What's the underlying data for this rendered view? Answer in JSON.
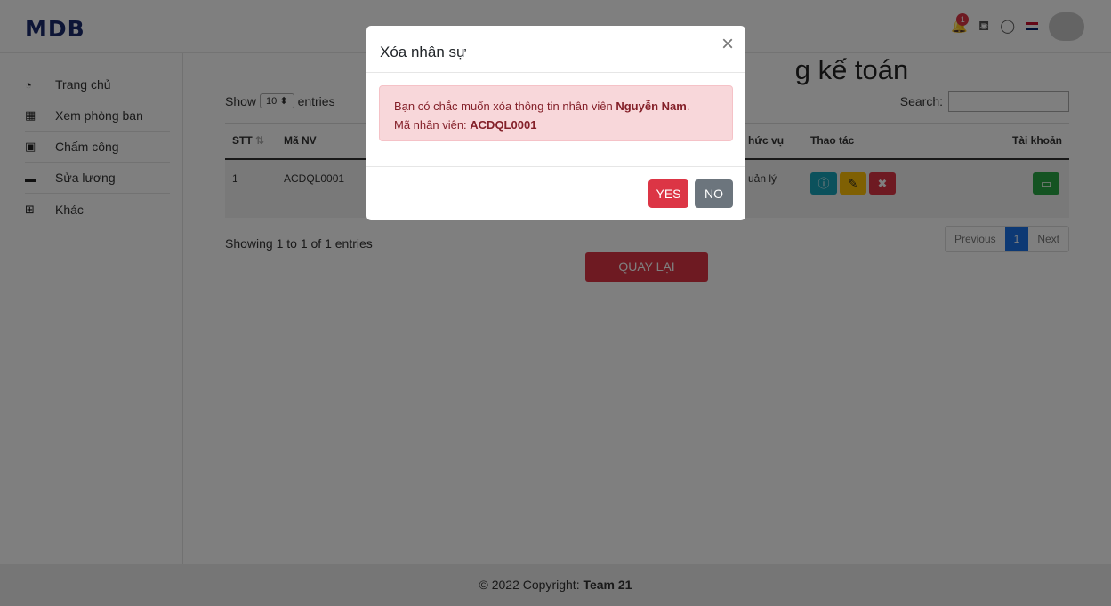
{
  "header": {
    "logo": "MDB",
    "notification_count": "1"
  },
  "sidebar": {
    "items": [
      {
        "label": "Trang chủ",
        "icon": "dashboard-icon"
      },
      {
        "label": "Xem phòng ban",
        "icon": "building-icon"
      },
      {
        "label": "Chấm công",
        "icon": "calendar-icon"
      },
      {
        "label": "Sửa lương",
        "icon": "money-icon"
      },
      {
        "label": "Khác",
        "icon": "grid-icon"
      }
    ]
  },
  "main": {
    "title_fragment": "g kế toán",
    "show_label": "Show",
    "entries_select": "10",
    "entries_label": "entries",
    "search_label": "Search:",
    "table": {
      "headers": [
        "STT",
        "Mã NV",
        "hức vụ",
        "Thao tác",
        "Tài khoản"
      ],
      "rows": [
        {
          "stt": "1",
          "ma_nv": "ACDQL0001",
          "chuc_vu": "uản lý"
        }
      ]
    },
    "showing": "Showing 1 to 1 of 1 entries",
    "pager": {
      "previous": "Previous",
      "current": "1",
      "next": "Next"
    },
    "back_button": "QUAY LẠI"
  },
  "footer": {
    "copyright": "© 2022 Copyright: ",
    "team": "Team 21"
  },
  "modal": {
    "title": "Xóa nhân sự",
    "close": "×",
    "message_prefix": "Bạn có chắc muốn xóa thông tin nhân viên ",
    "employee_name": "Nguyễn Nam",
    "message_suffix": ".",
    "id_label": "Mã nhân viên: ",
    "employee_id": "ACDQL0001",
    "yes": "YES",
    "no": "NO"
  }
}
